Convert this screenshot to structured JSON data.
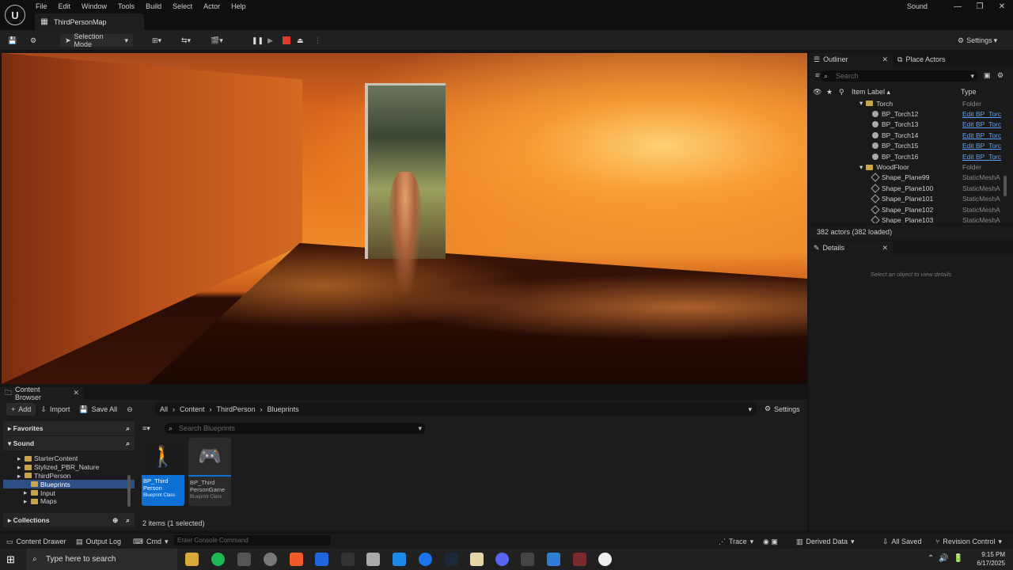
{
  "menu": [
    "File",
    "Edit",
    "Window",
    "Tools",
    "Build",
    "Select",
    "Actor",
    "Help"
  ],
  "map_tab": "ThirdPersonMap",
  "project": "Sound",
  "toolbar": {
    "selection_mode": "Selection Mode",
    "settings": "Settings"
  },
  "outliner": {
    "tab": "Outliner",
    "place_actors": "Place Actors",
    "search_placeholder": "Search",
    "col_label": "Item Label",
    "col_type": "Type",
    "rows": [
      {
        "label": "Torch",
        "type": "Folder",
        "kind": "folder",
        "indent": 1
      },
      {
        "label": "BP_Torch12",
        "type": "Edit BP_Torc",
        "kind": "actor",
        "indent": 2
      },
      {
        "label": "BP_Torch13",
        "type": "Edit BP_Torc",
        "kind": "actor",
        "indent": 2
      },
      {
        "label": "BP_Torch14",
        "type": "Edit BP_Torc",
        "kind": "actor",
        "indent": 2
      },
      {
        "label": "BP_Torch15",
        "type": "Edit BP_Torc",
        "kind": "actor",
        "indent": 2
      },
      {
        "label": "BP_Torch16",
        "type": "Edit BP_Torc",
        "kind": "actor",
        "indent": 2
      },
      {
        "label": "WoodFloor",
        "type": "Folder",
        "kind": "folder",
        "indent": 1
      },
      {
        "label": "Shape_Plane99",
        "type": "StaticMeshA",
        "kind": "mesh",
        "indent": 2
      },
      {
        "label": "Shape_Plane100",
        "type": "StaticMeshA",
        "kind": "mesh",
        "indent": 2
      },
      {
        "label": "Shape_Plane101",
        "type": "StaticMeshA",
        "kind": "mesh",
        "indent": 2
      },
      {
        "label": "Shape_Plane102",
        "type": "StaticMeshA",
        "kind": "mesh",
        "indent": 2
      },
      {
        "label": "Shape_Plane103",
        "type": "StaticMeshA",
        "kind": "mesh",
        "indent": 2
      }
    ],
    "footer": "382 actors (382 loaded)"
  },
  "details": {
    "tab": "Details",
    "empty": "Select an object to view details"
  },
  "content_browser": {
    "tab": "Content Browser",
    "add": "Add",
    "import": "Import",
    "save_all": "Save All",
    "path": [
      "All",
      "Content",
      "ThirdPerson",
      "Blueprints"
    ],
    "settings": "Settings",
    "favorites": "Favorites",
    "project": "Sound",
    "tree": [
      {
        "label": "StarterContent",
        "indent": 1,
        "selected": false
      },
      {
        "label": "Stylized_PBR_Nature",
        "indent": 1,
        "selected": false
      },
      {
        "label": "ThirdPerson",
        "indent": 1,
        "selected": false
      },
      {
        "label": "Blueprints",
        "indent": 2,
        "selected": true
      },
      {
        "label": "Input",
        "indent": 2,
        "selected": false
      },
      {
        "label": "Maps",
        "indent": 2,
        "selected": false
      }
    ],
    "collections": "Collections",
    "search_placeholder": "Search Blueprints",
    "assets": [
      {
        "name": "BP_Third Person",
        "class": "Blueprint Class",
        "selected": true
      },
      {
        "name": "BP_Third PersonGame",
        "class": "Blueprint Class",
        "selected": false
      }
    ],
    "count": "2 items (1 selected)"
  },
  "statusbar": {
    "content_drawer": "Content Drawer",
    "output_log": "Output Log",
    "cmd": "Cmd",
    "console_placeholder": "Enter Console Command",
    "trace": "Trace",
    "derived_data": "Derived Data",
    "all_saved": "All Saved",
    "revision_control": "Revision Control"
  },
  "taskbar": {
    "search": "Type here to search",
    "time": "9:15 PM",
    "date": "6/17/2025"
  },
  "colors": {
    "accent_blue": "#0e6fd4",
    "folder": "#c9a44a",
    "link": "#5aa0ff",
    "stop_red": "#e03a2e"
  }
}
